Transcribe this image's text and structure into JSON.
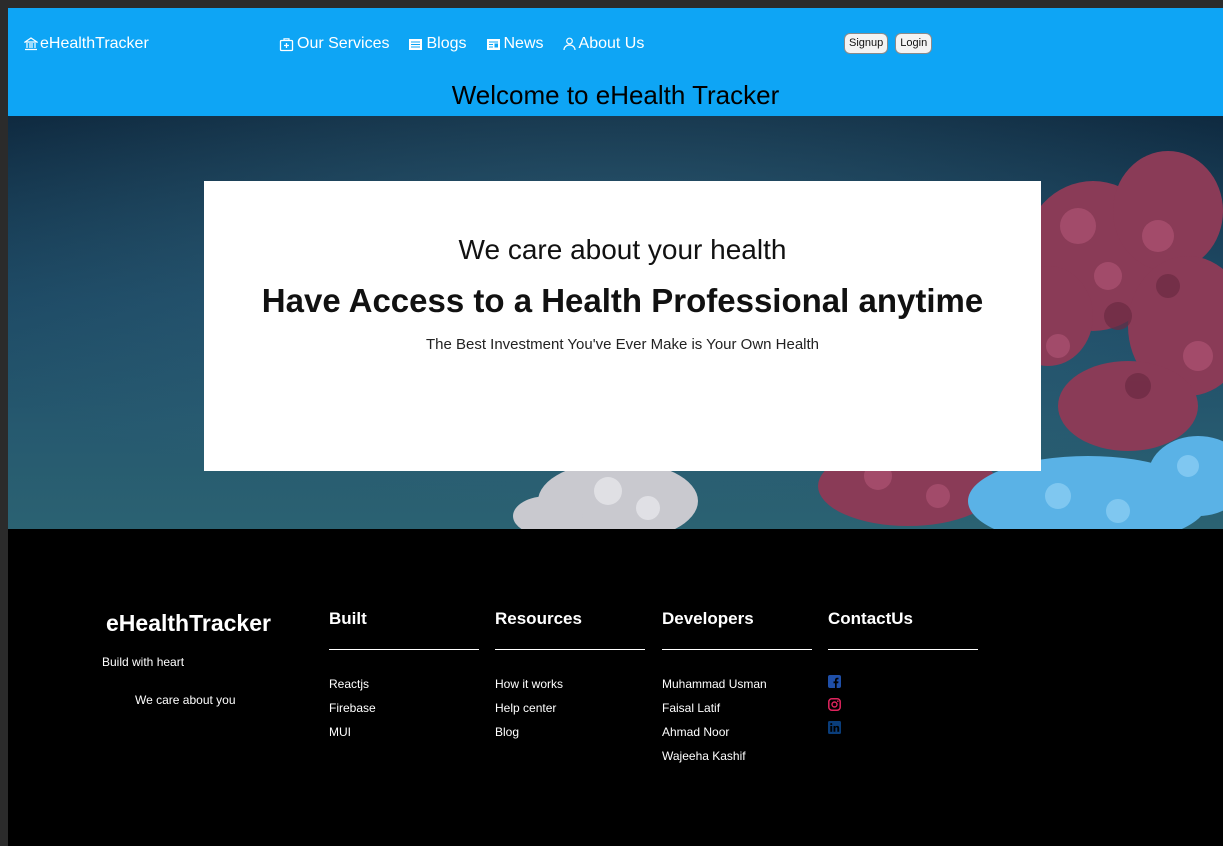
{
  "header": {
    "brand": "eHealthTracker",
    "nav": {
      "services": "Our Services",
      "blogs": "Blogs",
      "news": "News",
      "about": "About Us"
    },
    "signup_label": "Signup",
    "login_label": "Login",
    "welcome": "Welcome to eHealth Tracker",
    "color": "#0ea5f5"
  },
  "hero": {
    "tagline": "We care about your health",
    "headline": "Have Access to a Health Professional anytime",
    "subline": "The Best Investment You've Ever Make is Your Own Health"
  },
  "footer": {
    "brand": "eHealthTracker",
    "line1": "Build with heart",
    "line2": "We care about you",
    "built": {
      "title": "Built",
      "items": [
        "Reactjs",
        "Firebase",
        "MUI"
      ]
    },
    "resources": {
      "title": "Resources",
      "items": [
        "How it works",
        "Help center",
        "Blog"
      ]
    },
    "developers": {
      "title": "Developers",
      "items": [
        "Muhammad Usman",
        "Faisal Latif",
        "Ahmad Noor",
        "Wajeeha Kashif"
      ]
    },
    "contact": {
      "title": "ContactUs",
      "icons": [
        "facebook-icon",
        "instagram-icon",
        "linkedin-icon"
      ]
    }
  }
}
